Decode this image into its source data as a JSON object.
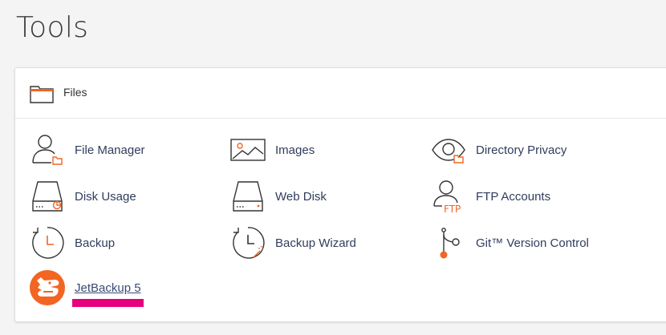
{
  "page": {
    "title": "Tools"
  },
  "section": {
    "title": "Files"
  },
  "items": [
    {
      "label": "File Manager"
    },
    {
      "label": "Images"
    },
    {
      "label": "Directory Privacy"
    },
    {
      "label": "Disk Usage"
    },
    {
      "label": "Web Disk"
    },
    {
      "label": "FTP Accounts"
    },
    {
      "label": "Backup"
    },
    {
      "label": "Backup Wizard"
    },
    {
      "label": "Git™ Version Control"
    },
    {
      "label": "JetBackup 5"
    }
  ],
  "icons": {
    "ftp_badge": "FTP"
  },
  "colors": {
    "accent_orange": "#f26522",
    "highlight": "#e6007e",
    "link": "#2f3d5c",
    "icon_stroke": "#333333"
  }
}
